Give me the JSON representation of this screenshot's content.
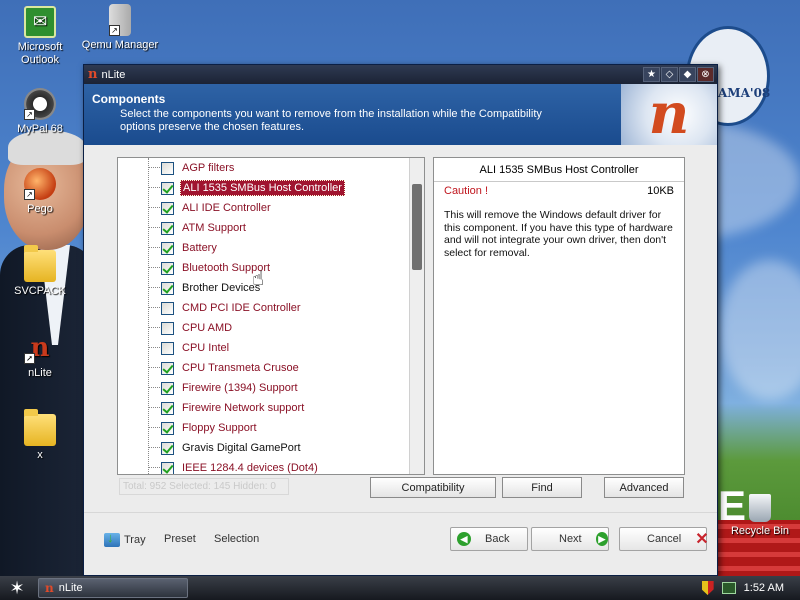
{
  "desktop": {
    "icons": [
      {
        "label": "Microsoft Outlook",
        "icon": "outlook-icon"
      },
      {
        "label": "Qemu Manager",
        "icon": "qemu-icon"
      },
      {
        "label": "MyPal 68",
        "icon": "mypal-icon"
      },
      {
        "label": "Pego",
        "icon": "pego-icon"
      },
      {
        "label": "SVCPACK",
        "icon": "folder-icon"
      },
      {
        "label": "nLite",
        "icon": "nlite-icon"
      },
      {
        "label": "x",
        "icon": "folder-icon"
      },
      {
        "label": "Recycle Bin",
        "icon": "recycle-bin-icon"
      }
    ],
    "wallpaper_text": "AMA'08",
    "big_letter": "E"
  },
  "window": {
    "title": "nLite",
    "header": {
      "title": "Components",
      "subtitle": "Select the components you want to remove from the installation while the Compatibility options preserve the chosen features."
    },
    "tree": {
      "items": [
        {
          "label": "AGP filters",
          "checked": false,
          "color": "red"
        },
        {
          "label": "ALI 1535 SMBus Host Controller",
          "checked": true,
          "color": "selected"
        },
        {
          "label": "ALI IDE Controller",
          "checked": true,
          "color": "red"
        },
        {
          "label": "ATM Support",
          "checked": true,
          "color": "red"
        },
        {
          "label": "Battery",
          "checked": true,
          "color": "red"
        },
        {
          "label": "Bluetooth Support",
          "checked": true,
          "color": "red"
        },
        {
          "label": "Brother Devices",
          "checked": true,
          "color": "black"
        },
        {
          "label": "CMD PCI IDE Controller",
          "checked": false,
          "color": "red"
        },
        {
          "label": "CPU AMD",
          "checked": false,
          "color": "red"
        },
        {
          "label": "CPU Intel",
          "checked": false,
          "color": "red"
        },
        {
          "label": "CPU Transmeta Crusoe",
          "checked": true,
          "color": "red"
        },
        {
          "label": "Firewire (1394) Support",
          "checked": true,
          "color": "red"
        },
        {
          "label": "Firewire Network support",
          "checked": true,
          "color": "red"
        },
        {
          "label": "Floppy Support",
          "checked": true,
          "color": "red"
        },
        {
          "label": "Gravis Digital GamePort",
          "checked": true,
          "color": "black"
        },
        {
          "label": "IEEE 1284.4 devices (Dot4)",
          "checked": true,
          "color": "red"
        }
      ],
      "scroll_position": 0.12
    },
    "info": {
      "title": "ALI 1535 SMBus Host Controller",
      "caution_label": "Caution !",
      "size": "10KB",
      "description": "This will remove the Windows default driver for this component. If you have this type of hardware and will not integrate your own driver, then don't select for removal."
    },
    "status": "Total: 952 Selected: 145 Hidden: 0",
    "buttons": {
      "compatibility": "Compatibility",
      "find": "Find",
      "advanced": "Advanced"
    },
    "footer": {
      "tray": "Tray",
      "preset": "Preset",
      "selection": "Selection",
      "back": "Back",
      "next": "Next",
      "cancel": "Cancel"
    }
  },
  "taskbar": {
    "task_label": "nLite",
    "clock": "1:52 AM"
  },
  "colors": {
    "selected_bg": "#a0142f",
    "item_red": "#8a1126",
    "header_blue": "#1a4b8e",
    "check_green": "#21a121"
  }
}
